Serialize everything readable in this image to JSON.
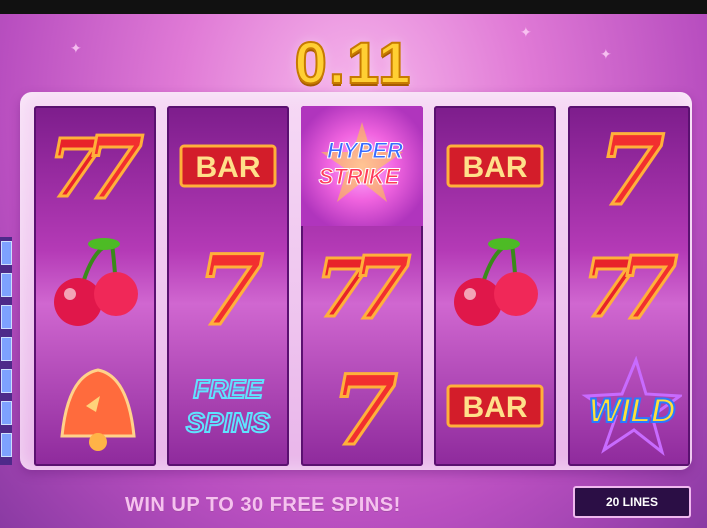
{
  "win_amount": "0.11",
  "promo_text": "WIN UP TO 30 FREE SPINS!",
  "lines_label": "20 LINES",
  "symbol_labels": {
    "bar": "BAR",
    "hyper": "HYPER",
    "strike": "STRIKE",
    "free": "FREE",
    "spins": "SPINS",
    "wild": "WILD"
  },
  "reels": [
    [
      "double-seven",
      "cherry",
      "bell"
    ],
    [
      "bar",
      "seven",
      "free-spins"
    ],
    [
      "hyper-strike",
      "double-seven",
      "seven"
    ],
    [
      "bar",
      "cherry",
      "bar"
    ],
    [
      "seven",
      "double-seven",
      "wild"
    ]
  ],
  "colors": {
    "win_gold": "#ffcf33",
    "reel_purple": "#b43ab6",
    "seven_red": "#e8222a"
  }
}
